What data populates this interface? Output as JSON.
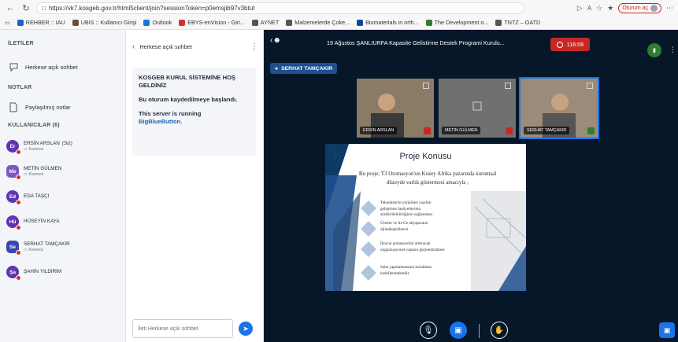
{
  "browser": {
    "url": "https://vk7.kosgeb.gov.tr/html5client/join?sessionToken=p0emsjib97v3btuf",
    "profile_label": "Oturum aç",
    "bookmarks": [
      {
        "label": "REHBER :: IAU",
        "color": "#1565c0"
      },
      {
        "label": "UBIS :: Kullanıcı Girişi",
        "color": "#6d4c41"
      },
      {
        "label": "Outlook",
        "color": "#1976d2"
      },
      {
        "label": "EBYS-enVision - Giri...",
        "color": "#d32f2f"
      },
      {
        "label": "AYNET",
        "color": "#555555"
      },
      {
        "label": "Malzemelerde Çoke...",
        "color": "#555555"
      },
      {
        "label": "Biomaterials in orth...",
        "color": "#0d47a1"
      },
      {
        "label": "The Development o...",
        "color": "#2e7d32"
      },
      {
        "label": "TNTZ – OATD",
        "color": "#555555"
      }
    ]
  },
  "sidebar": {
    "messages_title": "İLETİLER",
    "public_chat": "Herkese açık sohbet",
    "notes_title": "NOTLAR",
    "shared_notes": "Paylaşılmış notlar",
    "users_title": "KULLANICILAR (6)",
    "users": [
      {
        "initials": "Er",
        "name": "ERSİN ARSLAN",
        "you_label": "(Siz)",
        "sub": "Kamera",
        "color": "#5e35b1",
        "round": true
      },
      {
        "initials": "Me",
        "name": "METİN GÜLMEN",
        "you_label": "",
        "sub": "Kamera",
        "color": "#7e57c2",
        "round": false
      },
      {
        "initials": "Ed",
        "name": "EDA TAŞÇI",
        "you_label": "",
        "sub": "",
        "color": "#5e35b1",
        "round": true
      },
      {
        "initials": "Hü",
        "name": "HÜSEYİN KAYA",
        "you_label": "",
        "sub": "",
        "color": "#5e35b1",
        "round": true
      },
      {
        "initials": "Se",
        "name": "SERHAT TAMÇAKIR",
        "you_label": "",
        "sub": "Kamera",
        "color": "#3949ab",
        "round": false
      },
      {
        "initials": "Şa",
        "name": "ŞAHİN YILDIRIM",
        "you_label": "",
        "sub": "",
        "color": "#5e35b1",
        "round": true
      }
    ]
  },
  "chat": {
    "header": "Herkese açık sohbet",
    "welcome_title": "KOSGEB KURUL SİSTEMİNE HOŞ GELDİNİZ",
    "recording_notice": "Bu oturum kaydedilmeye başlandı.",
    "server_line": "This server is running",
    "server_link": "BigBlueButton.",
    "input_placeholder": "İleti Herkese açık sohbet"
  },
  "meeting": {
    "title": "19 Ağustos ŞANLIURFA Kapasite Gelistirme Destek Programi Kurulu...",
    "timer": "116:06",
    "presenter": "SERHAT TAMÇAKIR",
    "videos": [
      {
        "label": "ERSİN ARSLAN",
        "mic": "off",
        "bg": "#8a7a66"
      },
      {
        "label": "METİN GÜLMEN",
        "mic": "off",
        "bg": "#707070"
      },
      {
        "label": "SERHAT TAMÇAKIR",
        "mic": "on",
        "bg": "#9b8b7a"
      }
    ]
  },
  "slide": {
    "title": "Proje Konusu",
    "subtitle": "Bu proje; T3 Otomasyon'un Kuzey Afrika pazarında kurumsal düzeyde varlık göstermesi amacıyla ;",
    "bullets": [
      "Teknokent'te yürütülen yazılım geliştirme faaliyetlerinin sürdürülebilirliğinin sağlanması",
      "Üretim ve Ar-Ge altyapısının dijitalleştirilmesi",
      "İhracat potansiyelini arttıracak organizasyonel yapının güçlendirilmesi",
      "Saha yapılanmasının kurulması hedeflenmektedir."
    ]
  },
  "colors": {
    "accent": "#1a73e8",
    "main_bg": "#06172a",
    "record": "#c62828"
  }
}
